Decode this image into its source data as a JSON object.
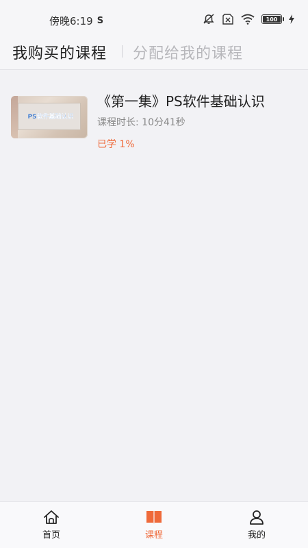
{
  "status_bar": {
    "time": "傍晚6:19",
    "s_icon": "S",
    "battery": "100"
  },
  "header": {
    "tab_active": "我购买的课程",
    "tab_inactive": "分配给我的课程"
  },
  "courses": [
    {
      "title": "《第一集》PS软件基础认识",
      "thumbnail_text": "PS软件基础认识",
      "duration": "课程时长: 10分41秒",
      "progress": "已学 1%"
    }
  ],
  "bottom_nav": {
    "home": "首页",
    "courses": "课程",
    "mine": "我的"
  },
  "colors": {
    "accent": "#ef6a3a",
    "background": "#f2f2f5"
  },
  "icons": [
    "bell-off-icon",
    "sim-x-icon",
    "wifi-icon",
    "battery-icon",
    "charging-icon",
    "home-icon",
    "book-icon",
    "user-icon"
  ]
}
